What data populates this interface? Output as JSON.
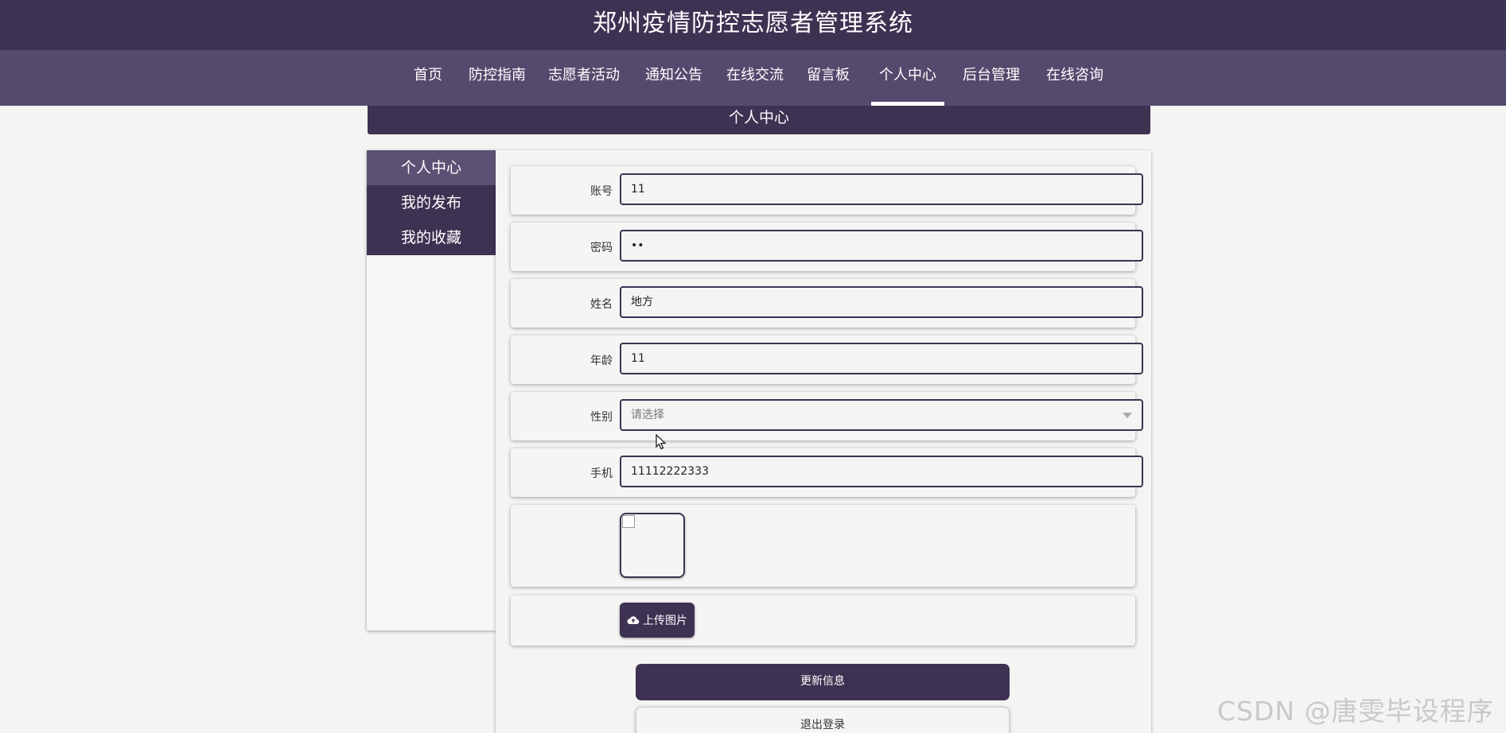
{
  "header": {
    "title": "郑州疫情防控志愿者管理系统"
  },
  "nav": {
    "items": [
      {
        "label": "首页"
      },
      {
        "label": "防控指南"
      },
      {
        "label": "志愿者活动"
      },
      {
        "label": "通知公告"
      },
      {
        "label": "在线交流"
      },
      {
        "label": "留言板"
      },
      {
        "label": "个人中心",
        "active": true
      },
      {
        "label": "后台管理"
      },
      {
        "label": "在线咨询"
      }
    ]
  },
  "page": {
    "banner": "个人中心"
  },
  "sidebar": {
    "items": [
      {
        "label": "个人中心",
        "active": true
      },
      {
        "label": "我的发布"
      },
      {
        "label": "我的收藏"
      }
    ]
  },
  "form": {
    "account": {
      "label": "账号",
      "value": "11"
    },
    "password": {
      "label": "密码",
      "value": "••"
    },
    "name": {
      "label": "姓名",
      "value": "地方"
    },
    "age": {
      "label": "年龄",
      "value": "11"
    },
    "gender": {
      "label": "性别",
      "placeholder": "请选择"
    },
    "phone": {
      "label": "手机",
      "value": "11112222333"
    },
    "upload_label": "上传图片",
    "update_label": "更新信息",
    "logout_label": "退出登录"
  },
  "watermark": "CSDN @唐雯毕设程序",
  "colors": {
    "primary": "#3d3252",
    "nav_bg": "#554a6d",
    "sidebar_active": "#5b5174"
  }
}
